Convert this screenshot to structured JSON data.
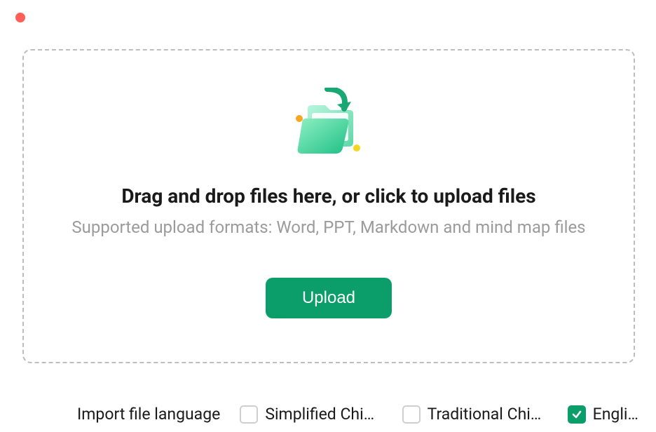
{
  "dropzone": {
    "headline": "Drag and drop files here, or click to upload files",
    "subline": "Supported upload formats: Word, PPT, Markdown and mind map files",
    "upload_label": "Upload"
  },
  "language": {
    "label": "Import file language",
    "options": {
      "simplified": {
        "label": "Simplified Chinese",
        "checked": false
      },
      "traditional": {
        "label": "Traditional Chinese",
        "checked": false
      },
      "english": {
        "label": "English",
        "checked": true
      }
    }
  },
  "icons": {
    "folder": "folder-import-icon",
    "check": "check-icon"
  },
  "colors": {
    "accent": "#0b9d6a",
    "close_dot": "#ff5f56"
  }
}
